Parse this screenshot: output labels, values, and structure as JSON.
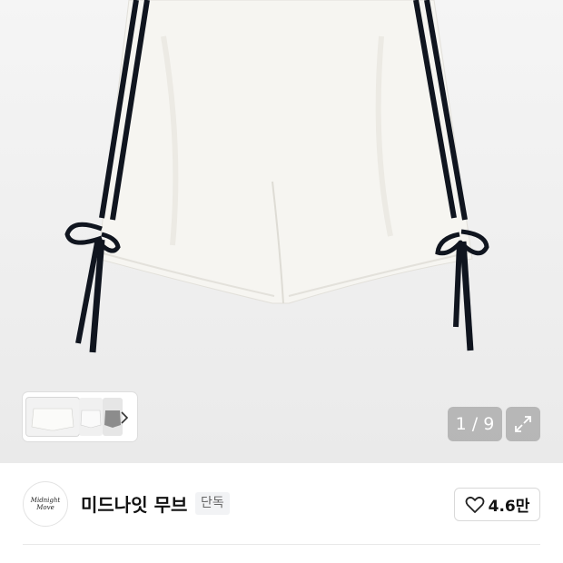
{
  "gallery": {
    "counter": "1 / 9",
    "thumbnails": [
      "thumbnail-1",
      "thumbnail-2",
      "thumbnail-3"
    ],
    "next_icon": "chevron-right-icon",
    "expand_icon": "expand-icon"
  },
  "brand": {
    "logo_text": "Midnight Move",
    "name": "미드나잇 무브",
    "badge": "단독",
    "like_count": "4.6만",
    "like_icon": "heart-outline-icon"
  },
  "colors": {
    "hero_bg": "#efefef",
    "counter_bg": "#9a9a9a",
    "stripe": "#10151f"
  }
}
